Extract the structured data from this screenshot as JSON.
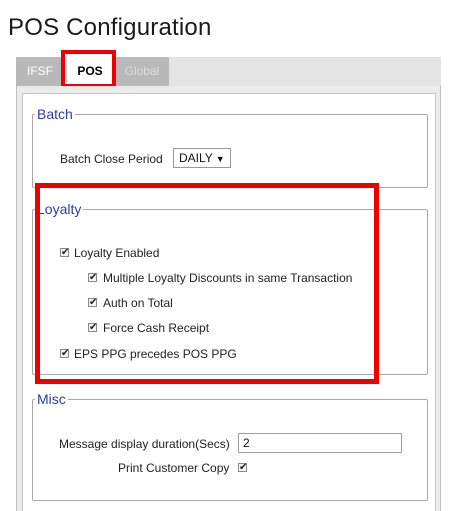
{
  "page_title": "POS Configuration",
  "tabs": [
    {
      "label": "IFSF"
    },
    {
      "label": "POS"
    },
    {
      "label": "Global"
    }
  ],
  "batch": {
    "legend": "Batch",
    "close_period_label": "Batch Close Period",
    "close_period_value": "DAILY",
    "caret": "▼"
  },
  "loyalty": {
    "legend": "Loyalty",
    "items": [
      {
        "label": "Loyalty Enabled",
        "checked": true
      },
      {
        "label": "Multiple Loyalty Discounts in same Transaction",
        "checked": true
      },
      {
        "label": "Auth on Total",
        "checked": true
      },
      {
        "label": "Force Cash Receipt",
        "checked": true
      },
      {
        "label": "EPS PPG precedes POS PPG",
        "checked": true
      }
    ]
  },
  "misc": {
    "legend": "Misc",
    "msg_duration_label": "Message display duration(Secs)",
    "msg_duration_value": "2",
    "print_copy_label": "Print Customer Copy",
    "print_copy_checked": true
  },
  "check_glyph": "✔",
  "colors": {
    "highlight": "#ee0000",
    "legend_text": "#2a3fa0"
  }
}
